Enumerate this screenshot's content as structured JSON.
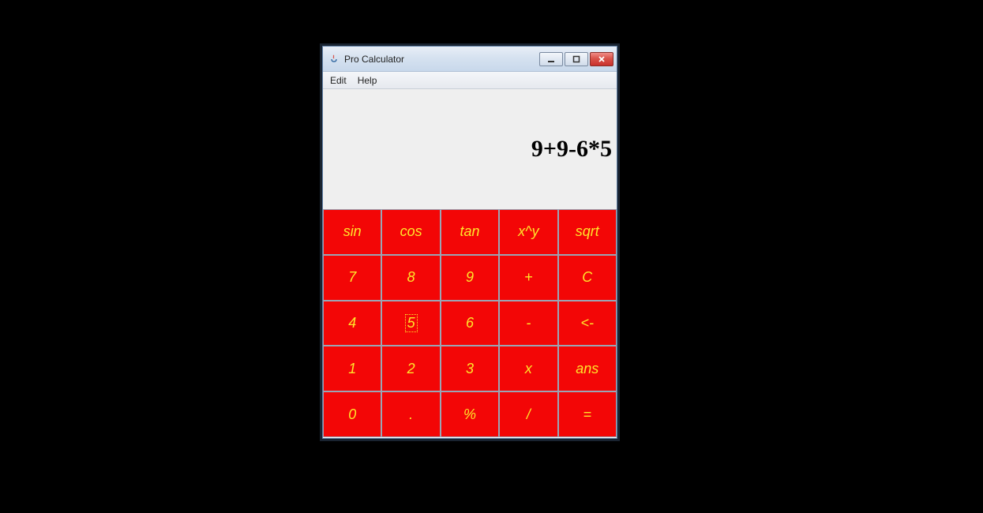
{
  "window": {
    "title": "Pro Calculator"
  },
  "menubar": {
    "items": [
      "Edit",
      "Help"
    ]
  },
  "display": {
    "value": "9+9-6*5"
  },
  "keypad": {
    "rows": [
      [
        {
          "label": "sin",
          "name": "sin-key"
        },
        {
          "label": "cos",
          "name": "cos-key"
        },
        {
          "label": "tan",
          "name": "tan-key"
        },
        {
          "label": "x^y",
          "name": "power-key"
        },
        {
          "label": "sqrt",
          "name": "sqrt-key"
        }
      ],
      [
        {
          "label": "7",
          "name": "digit-7-key"
        },
        {
          "label": "8",
          "name": "digit-8-key"
        },
        {
          "label": "9",
          "name": "digit-9-key"
        },
        {
          "label": "+",
          "name": "plus-key"
        },
        {
          "label": "C",
          "name": "clear-key"
        }
      ],
      [
        {
          "label": "4",
          "name": "digit-4-key"
        },
        {
          "label": "5",
          "name": "digit-5-key",
          "focused": true
        },
        {
          "label": "6",
          "name": "digit-6-key"
        },
        {
          "label": "-",
          "name": "minus-key"
        },
        {
          "label": "<-",
          "name": "backspace-key"
        }
      ],
      [
        {
          "label": "1",
          "name": "digit-1-key"
        },
        {
          "label": "2",
          "name": "digit-2-key"
        },
        {
          "label": "3",
          "name": "digit-3-key"
        },
        {
          "label": "x",
          "name": "multiply-key"
        },
        {
          "label": "ans",
          "name": "ans-key"
        }
      ],
      [
        {
          "label": "0",
          "name": "digit-0-key"
        },
        {
          "label": ".",
          "name": "decimal-key"
        },
        {
          "label": "%",
          "name": "percent-key"
        },
        {
          "label": "/",
          "name": "divide-key"
        },
        {
          "label": "=",
          "name": "equals-key"
        }
      ]
    ]
  }
}
